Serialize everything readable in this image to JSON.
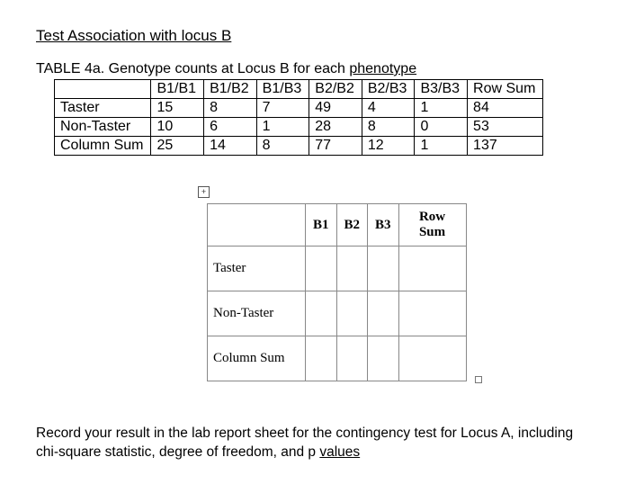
{
  "title": "Test Association with locus B",
  "caption_lead": "TABLE 4a. Genotype counts at Locus B for each ",
  "caption_tail": "phenotype",
  "t4a": {
    "headers": [
      "",
      "B1/B1",
      "B1/B2",
      "B1/B3",
      "B2/B2",
      "B2/B3",
      "B3/B3",
      "Row Sum"
    ],
    "rows": [
      [
        "Taster",
        "15",
        "8",
        "7",
        "49",
        "4",
        "1",
        "84"
      ],
      [
        "Non-Taster",
        "10",
        "6",
        "1",
        "28",
        "8",
        "0",
        "53"
      ],
      [
        "Column Sum",
        "25",
        "14",
        "8",
        "77",
        "12",
        "1",
        "137"
      ]
    ]
  },
  "handle_glyph": "+",
  "t4b": {
    "headers": [
      "",
      "B1",
      "B2",
      "B3",
      "Row Sum"
    ],
    "rows": [
      "Taster",
      "Non-Taster",
      "Column Sum"
    ]
  },
  "instruction_pre": "Record your result in the lab report sheet for the contingency test for Locus A, including chi-square statistic, degree of freedom, and p ",
  "instruction_link": "values",
  "chart_data": {
    "type": "table",
    "title": "TABLE 4a. Genotype counts at Locus B for each phenotype",
    "columns": [
      "B1/B1",
      "B1/B2",
      "B1/B3",
      "B2/B2",
      "B2/B3",
      "B3/B3",
      "Row Sum"
    ],
    "rows": [
      {
        "label": "Taster",
        "values": [
          15,
          8,
          7,
          49,
          4,
          1,
          84
        ]
      },
      {
        "label": "Non-Taster",
        "values": [
          10,
          6,
          1,
          28,
          8,
          0,
          53
        ]
      },
      {
        "label": "Column Sum",
        "values": [
          25,
          14,
          8,
          77,
          12,
          1,
          137
        ]
      }
    ]
  }
}
